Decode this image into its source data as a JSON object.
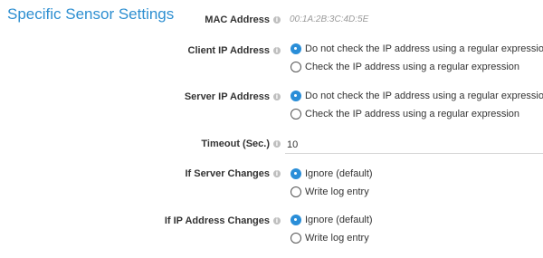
{
  "section": {
    "title": "Specific Sensor Settings"
  },
  "info_icon": "info-icon",
  "fields": {
    "mac": {
      "label": "MAC Address",
      "value": "00:1A:2B:3C:4D:5E"
    },
    "client_ip": {
      "label": "Client IP Address",
      "options": [
        "Do not check the IP address using a regular expression",
        "Check the IP address using a regular expression"
      ],
      "selected": 0
    },
    "server_ip": {
      "label": "Server IP Address",
      "options": [
        "Do not check the IP address using a regular expression",
        "Check the IP address using a regular expression"
      ],
      "selected": 0
    },
    "timeout": {
      "label": "Timeout (Sec.)",
      "value": "10"
    },
    "server_changes": {
      "label": "If Server Changes",
      "options": [
        "Ignore (default)",
        "Write log entry"
      ],
      "selected": 0
    },
    "ip_changes": {
      "label": "If IP Address Changes",
      "options": [
        "Ignore (default)",
        "Write log entry"
      ],
      "selected": 0
    }
  },
  "colors": {
    "accent": "#2a8ed8",
    "title": "#2e8fd1"
  }
}
